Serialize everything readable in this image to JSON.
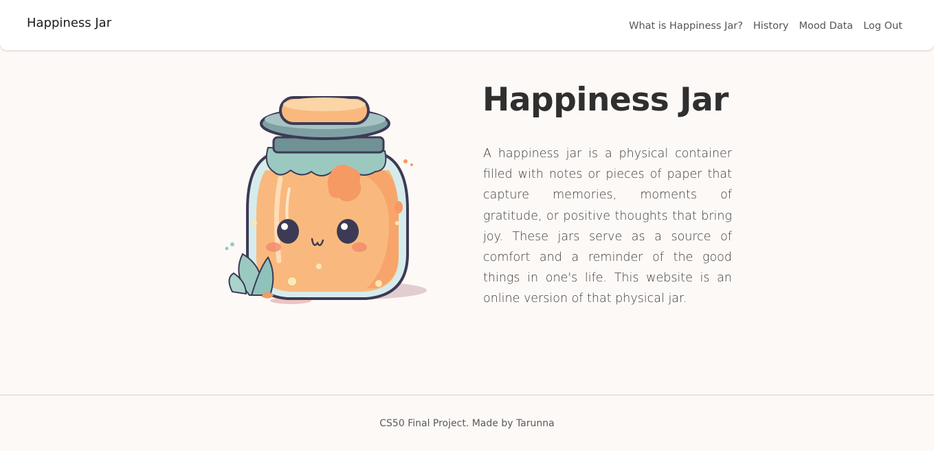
{
  "navbar": {
    "brand": "Happiness Jar",
    "links": [
      {
        "label": "What is Happiness Jar?"
      },
      {
        "label": "History"
      },
      {
        "label": "Mood Data"
      },
      {
        "label": "Log Out"
      }
    ]
  },
  "hero": {
    "title": "Happiness Jar",
    "description": "A happiness jar is a physical container filled with notes or pieces of paper that capture memories, moments of gratitude, or positive thoughts that bring joy. These jars serve as a source of comfort and a reminder of the good things in one's life. This website is an online version of that physical jar.",
    "image_icon": "cute-happiness-jar-icon"
  },
  "footer": {
    "text": "CS50 Final Project. Made by Tarunna"
  },
  "colors": {
    "background": "#fdf9f7",
    "navbar": "#ffffff",
    "jar_fill": "#f9b97e",
    "jar_lid": "#7fa0a3",
    "jar_cloth": "#9bc9c0",
    "outline": "#3d3a55"
  }
}
